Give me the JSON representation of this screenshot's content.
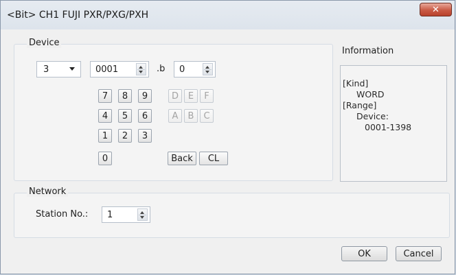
{
  "window": {
    "title": "<Bit> CH1 FUJI PXR/PXG/PXH",
    "close_glyph": "✕"
  },
  "device": {
    "group_label": "Device",
    "type_select": "3",
    "address": "0001",
    "bit_label": ".b",
    "bit": "0",
    "keypad": {
      "numeric": [
        "7",
        "8",
        "9",
        "4",
        "5",
        "6",
        "1",
        "2",
        "3",
        "0"
      ],
      "hex": [
        "D",
        "E",
        "F",
        "A",
        "B",
        "C"
      ],
      "back_label": "Back",
      "clear_label": "CL"
    }
  },
  "information": {
    "title": "Information",
    "lines": [
      "[Kind]",
      "WORD",
      "[Range]",
      "Device:",
      "0001-1398"
    ]
  },
  "network": {
    "group_label": "Network",
    "station_label": "Station No.:",
    "station_value": "1"
  },
  "buttons": {
    "ok": "OK",
    "cancel": "Cancel"
  }
}
